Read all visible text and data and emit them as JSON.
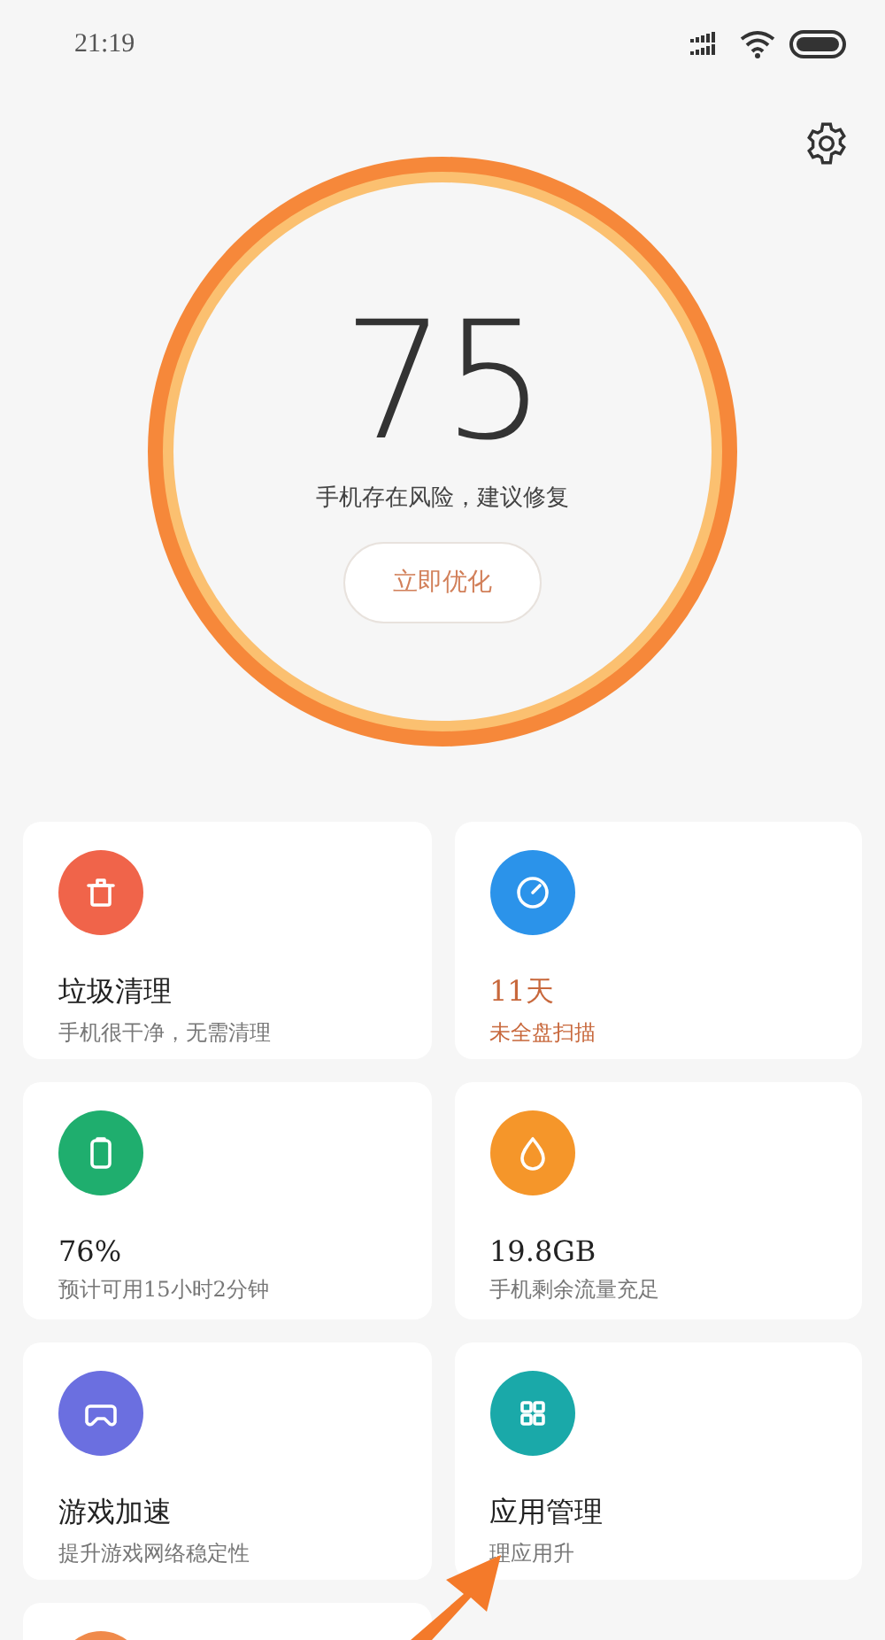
{
  "status_bar": {
    "time": "21:19"
  },
  "score": {
    "value": "75",
    "message": "手机存在风险，建议修复",
    "button": "立即优化"
  },
  "cards": [
    {
      "title": "垃圾清理",
      "subtitle": "手机很干净，无需清理",
      "color": "#f0644a",
      "alert": false
    },
    {
      "title": "11天",
      "subtitle": "未全盘扫描",
      "color": "#2b93ea",
      "alert": true
    },
    {
      "title": "76%",
      "subtitle": "预计可用15小时2分钟",
      "color": "#1fae6e",
      "alert": false
    },
    {
      "title": "19.8GB",
      "subtitle": "手机剩余流量充足",
      "color": "#f5962a",
      "alert": false
    },
    {
      "title": "游戏加速",
      "subtitle": "提升游戏网络稳定性",
      "color": "#6b6fe0",
      "alert": false
    },
    {
      "title": "应用管理",
      "subtitle": "理应用升",
      "color": "#1aa9a9",
      "alert": false
    }
  ],
  "partial_card": {
    "color": "#f08a4b"
  }
}
